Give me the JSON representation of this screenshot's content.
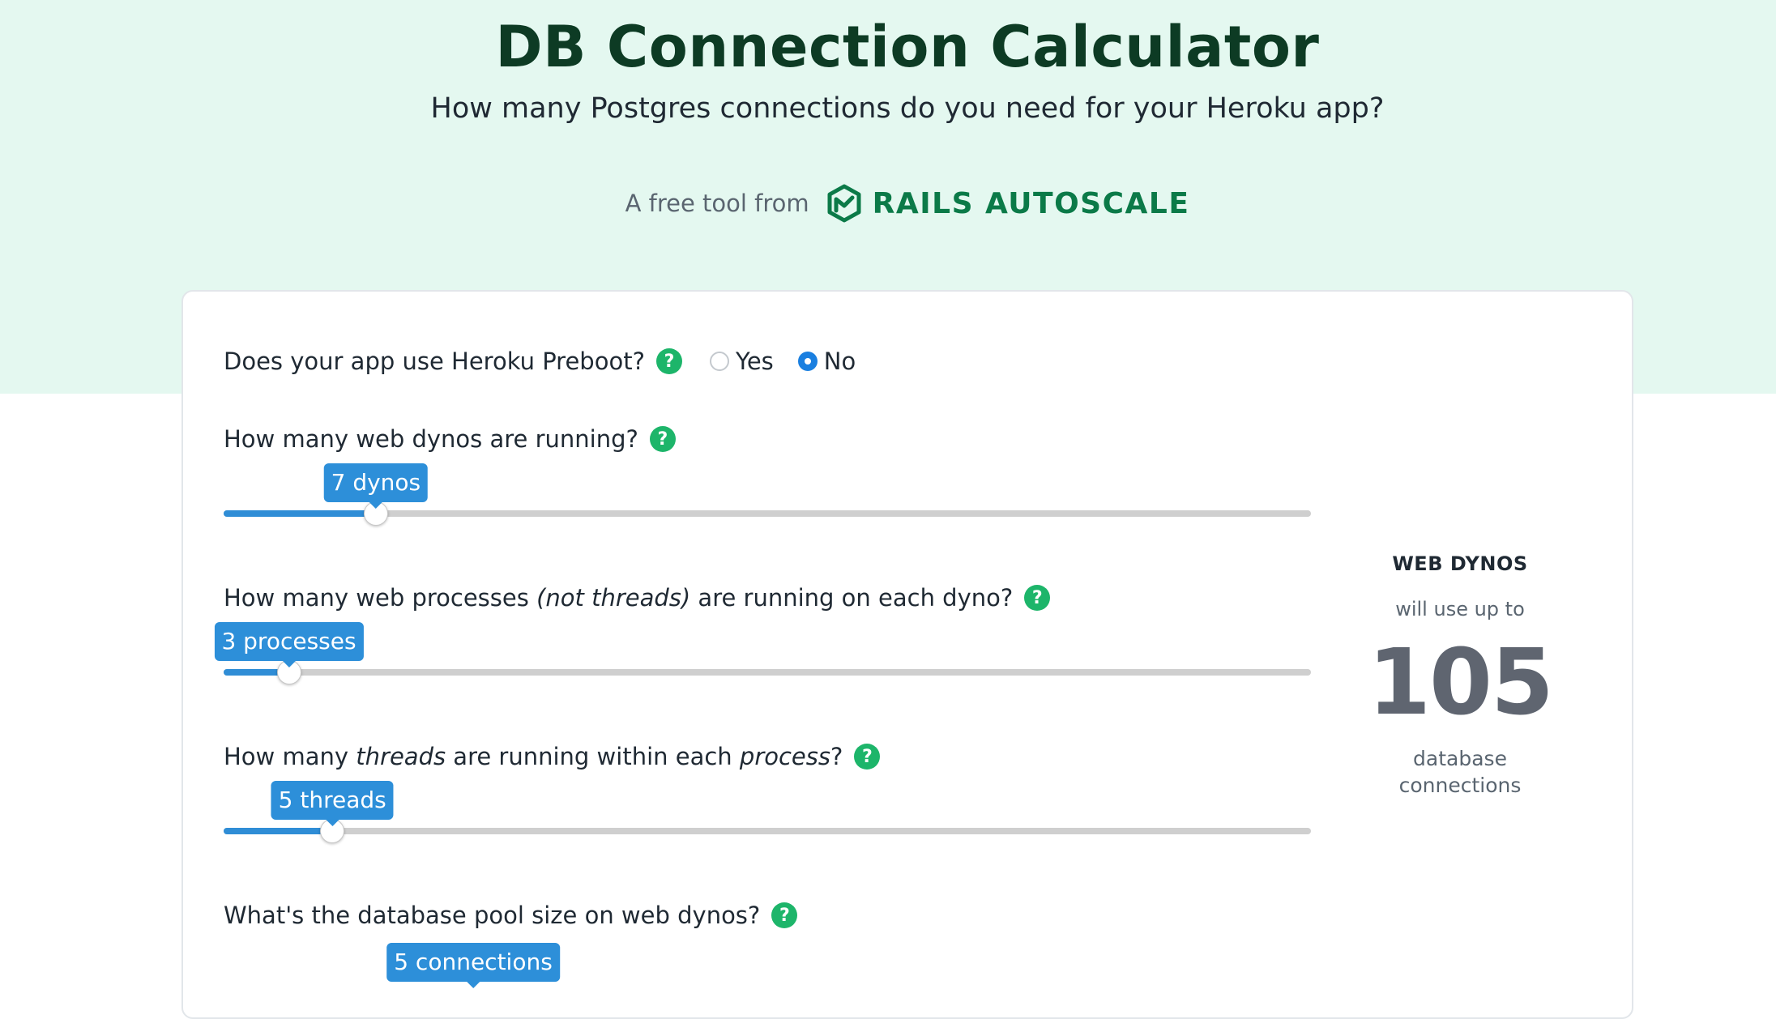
{
  "header": {
    "title": "DB Connection Calculator",
    "subtitle": "How many Postgres connections do you need for your Heroku app?",
    "credit_text": "A free tool from",
    "brand_name": "RAILS AUTOSCALE",
    "brand_icon": "rails-autoscale-logo-icon",
    "colors": {
      "hero_bg": "#e4f8f0",
      "title": "#0d3b24",
      "brand": "#0b7a48"
    }
  },
  "preboot": {
    "question": "Does your app use Heroku Preboot?",
    "help": "?",
    "options": [
      {
        "label": "Yes",
        "checked": false
      },
      {
        "label": "No",
        "checked": true
      }
    ]
  },
  "dynos": {
    "question": "How many web dynos are running?",
    "help": "?",
    "bubble": "7 dynos",
    "level": 0.14
  },
  "processes": {
    "question_a": "How many web processes ",
    "question_em": "(not threads)",
    "question_b": " are running on each dyno?",
    "help": "?",
    "bubble": "3 processes",
    "level": 0.06
  },
  "threads": {
    "question_a": "How many ",
    "question_em1": "threads",
    "question_b": " are running within each ",
    "question_em2": "process",
    "question_c": "?",
    "help": "?",
    "bubble": "5 threads",
    "level": 0.1
  },
  "pool": {
    "question": "What's the database pool size on web dynos?",
    "help": "?",
    "bubble": "5 connections"
  },
  "result": {
    "label": "WEB DYNOS",
    "pre": "will use up to",
    "number": "105",
    "post": "database connections"
  },
  "accent": {
    "slider": "#2d8fd9",
    "help": "#1db56a",
    "radio": "#1a7fe0"
  }
}
